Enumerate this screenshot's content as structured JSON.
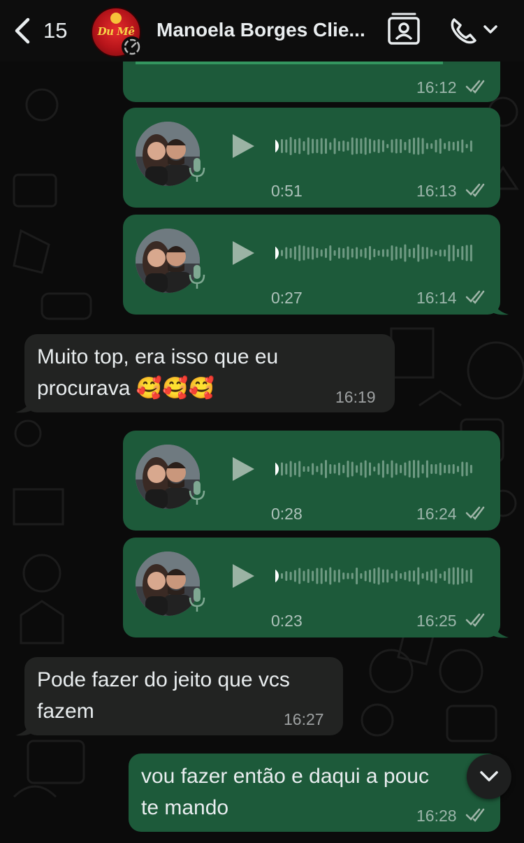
{
  "header": {
    "back_count": "15",
    "contact_name": "Manoela Borges Clie...",
    "avatar_logo": "Du Mê"
  },
  "messages": [
    {
      "type": "voice",
      "direction": "out",
      "duration": "0:51",
      "time": "16:13"
    },
    {
      "type": "voice",
      "direction": "out",
      "duration": "0:27",
      "time": "16:14"
    },
    {
      "type": "text",
      "direction": "in",
      "lines": [
        "Muito top, era isso que eu",
        "procurava 🥰🥰🥰"
      ],
      "time": "16:19"
    },
    {
      "type": "voice",
      "direction": "out",
      "duration": "0:28",
      "time": "16:24"
    },
    {
      "type": "voice",
      "direction": "out",
      "duration": "0:23",
      "time": "16:25"
    },
    {
      "type": "text",
      "direction": "in",
      "lines": [
        "Pode fazer do jeito que vcs",
        "fazem"
      ],
      "time": "16:27"
    },
    {
      "type": "text",
      "direction": "out",
      "lines": [
        "vou fazer então e daqui a pouc",
        "te mando"
      ],
      "time": "16:28"
    }
  ],
  "partial_top_message": {
    "time": "16:12"
  },
  "colors": {
    "outgoing_bubble": "#1d5a3a",
    "incoming_bubble": "#222322",
    "background": "#0b0b0b",
    "read_checks": "#9fb5a8"
  },
  "icons": [
    "chevron-left-icon",
    "status-icon",
    "contact-card-icon",
    "phone-icon",
    "chevron-down-icon",
    "play-icon",
    "microphone-icon",
    "double-check-icon",
    "scroll-down-icon"
  ]
}
